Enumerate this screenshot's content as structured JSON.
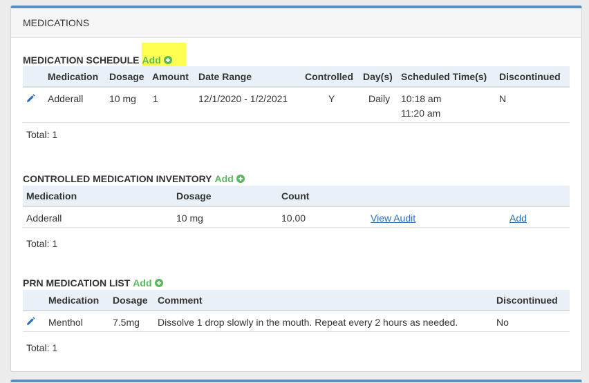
{
  "panel": {
    "title": "MEDICATIONS"
  },
  "schedule": {
    "title": "MEDICATION SCHEDULE",
    "add_label": "Add",
    "headers": [
      "Medication",
      "Dosage",
      "Amount",
      "Date Range",
      "Controlled",
      "Day(s)",
      "Scheduled Time(s)",
      "Discontinued"
    ],
    "rows": [
      {
        "medication": "Adderall",
        "dosage": "10 mg",
        "amount": "1",
        "date_range": "12/1/2020 - 1/2/2021",
        "controlled": "Y",
        "days": "Daily",
        "time1": "10:18 am",
        "time2": "11:20 am",
        "discontinued": "N"
      }
    ],
    "total": "Total: 1"
  },
  "inventory": {
    "title": "CONTROLLED MEDICATION INVENTORY",
    "add_label": "Add",
    "headers": [
      "Medication",
      "Dosage",
      "Count"
    ],
    "rows": [
      {
        "medication": "Adderall",
        "dosage": "10 mg",
        "count": "10.00",
        "view_audit": "View Audit",
        "add": "Add"
      }
    ],
    "total": "Total: 1"
  },
  "prn": {
    "title": "PRN MEDICATION LIST",
    "add_label": "Add",
    "headers": [
      "Medication",
      "Dosage",
      "Comment",
      "Discontinued"
    ],
    "rows": [
      {
        "medication": "Menthol",
        "dosage": "7.5mg",
        "comment": "Dissolve 1 drop slowly in the mouth. Repeat every 2 hours as needed.",
        "discontinued": "No"
      }
    ],
    "total": "Total: 1"
  },
  "colors": {
    "accent": "#5b8fbd",
    "add_green": "#5cb85c",
    "link_blue": "#2a6ebb",
    "header_bg": "#e8f0f8",
    "highlight": "#ffff33"
  },
  "icons": {
    "edit": "pencil-icon",
    "add": "plus-circle-icon"
  }
}
